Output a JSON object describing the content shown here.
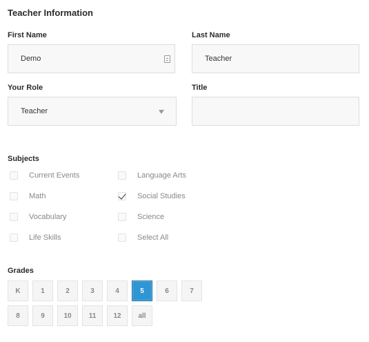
{
  "section": {
    "title": "Teacher Information"
  },
  "fields": {
    "first_name": {
      "label": "First Name",
      "value": "Demo"
    },
    "last_name": {
      "label": "Last Name",
      "value": "Teacher"
    },
    "role": {
      "label": "Your Role",
      "value": "Teacher"
    },
    "title": {
      "label": "Title",
      "value": ""
    }
  },
  "subjects": {
    "label": "Subjects",
    "items": [
      {
        "label": "Current Events",
        "checked": false
      },
      {
        "label": "Language Arts",
        "checked": false
      },
      {
        "label": "Math",
        "checked": false
      },
      {
        "label": "Social Studies",
        "checked": true
      },
      {
        "label": "Vocabulary",
        "checked": false
      },
      {
        "label": "Science",
        "checked": false
      },
      {
        "label": "Life Skills",
        "checked": false
      },
      {
        "label": "Select All",
        "checked": false
      }
    ]
  },
  "grades": {
    "label": "Grades",
    "items": [
      "K",
      "1",
      "2",
      "3",
      "4",
      "5",
      "6",
      "7",
      "8",
      "9",
      "10",
      "11",
      "12",
      "all"
    ],
    "selected": "5"
  },
  "colors": {
    "accent": "#2f95d3",
    "field_bg": "#f8f8f8",
    "field_border": "#dcdcdc"
  }
}
